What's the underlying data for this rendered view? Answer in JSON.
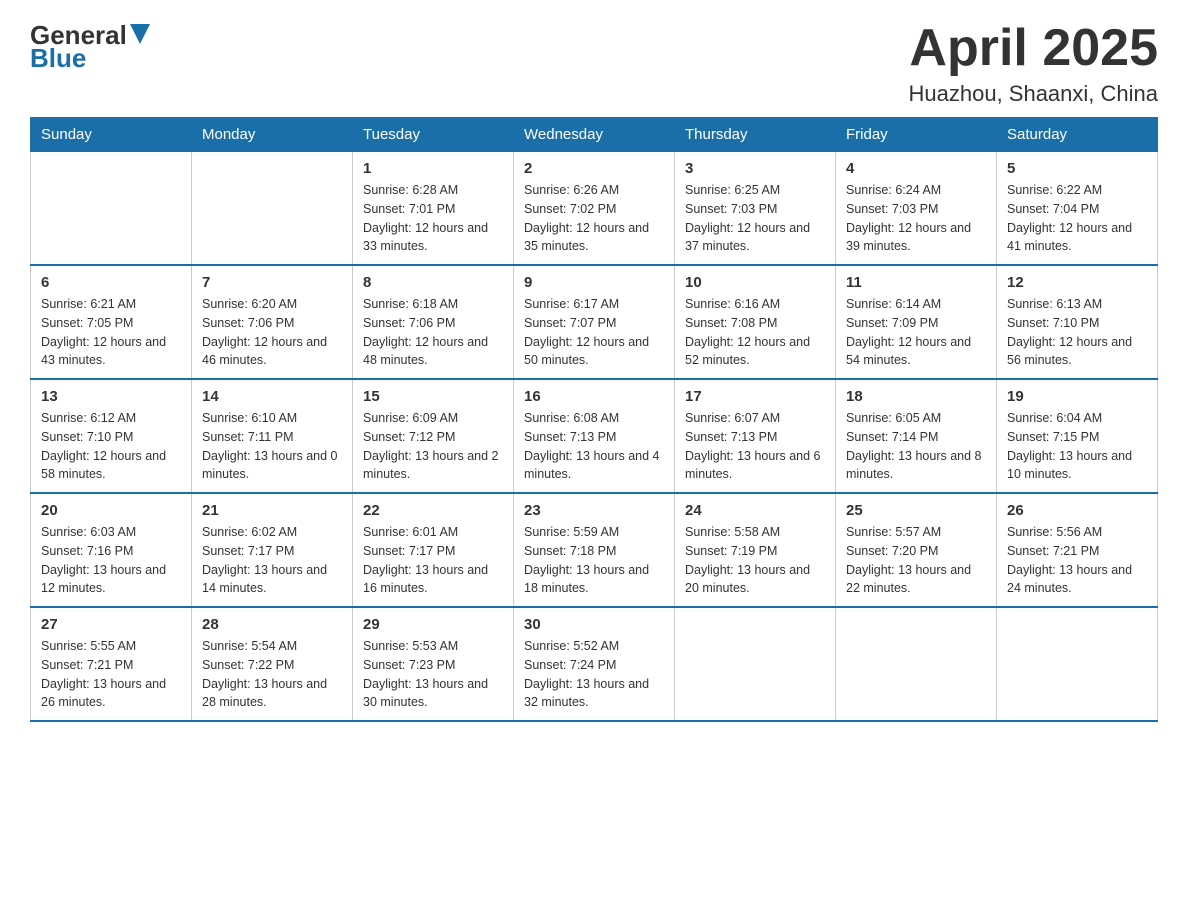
{
  "logo": {
    "general": "General",
    "blue": "Blue"
  },
  "title": "April 2025",
  "subtitle": "Huazhou, Shaanxi, China",
  "days_of_week": [
    "Sunday",
    "Monday",
    "Tuesday",
    "Wednesday",
    "Thursday",
    "Friday",
    "Saturday"
  ],
  "weeks": [
    [
      null,
      null,
      {
        "day": "1",
        "sunrise": "6:28 AM",
        "sunset": "7:01 PM",
        "daylight": "12 hours and 33 minutes."
      },
      {
        "day": "2",
        "sunrise": "6:26 AM",
        "sunset": "7:02 PM",
        "daylight": "12 hours and 35 minutes."
      },
      {
        "day": "3",
        "sunrise": "6:25 AM",
        "sunset": "7:03 PM",
        "daylight": "12 hours and 37 minutes."
      },
      {
        "day": "4",
        "sunrise": "6:24 AM",
        "sunset": "7:03 PM",
        "daylight": "12 hours and 39 minutes."
      },
      {
        "day": "5",
        "sunrise": "6:22 AM",
        "sunset": "7:04 PM",
        "daylight": "12 hours and 41 minutes."
      }
    ],
    [
      {
        "day": "6",
        "sunrise": "6:21 AM",
        "sunset": "7:05 PM",
        "daylight": "12 hours and 43 minutes."
      },
      {
        "day": "7",
        "sunrise": "6:20 AM",
        "sunset": "7:06 PM",
        "daylight": "12 hours and 46 minutes."
      },
      {
        "day": "8",
        "sunrise": "6:18 AM",
        "sunset": "7:06 PM",
        "daylight": "12 hours and 48 minutes."
      },
      {
        "day": "9",
        "sunrise": "6:17 AM",
        "sunset": "7:07 PM",
        "daylight": "12 hours and 50 minutes."
      },
      {
        "day": "10",
        "sunrise": "6:16 AM",
        "sunset": "7:08 PM",
        "daylight": "12 hours and 52 minutes."
      },
      {
        "day": "11",
        "sunrise": "6:14 AM",
        "sunset": "7:09 PM",
        "daylight": "12 hours and 54 minutes."
      },
      {
        "day": "12",
        "sunrise": "6:13 AM",
        "sunset": "7:10 PM",
        "daylight": "12 hours and 56 minutes."
      }
    ],
    [
      {
        "day": "13",
        "sunrise": "6:12 AM",
        "sunset": "7:10 PM",
        "daylight": "12 hours and 58 minutes."
      },
      {
        "day": "14",
        "sunrise": "6:10 AM",
        "sunset": "7:11 PM",
        "daylight": "13 hours and 0 minutes."
      },
      {
        "day": "15",
        "sunrise": "6:09 AM",
        "sunset": "7:12 PM",
        "daylight": "13 hours and 2 minutes."
      },
      {
        "day": "16",
        "sunrise": "6:08 AM",
        "sunset": "7:13 PM",
        "daylight": "13 hours and 4 minutes."
      },
      {
        "day": "17",
        "sunrise": "6:07 AM",
        "sunset": "7:13 PM",
        "daylight": "13 hours and 6 minutes."
      },
      {
        "day": "18",
        "sunrise": "6:05 AM",
        "sunset": "7:14 PM",
        "daylight": "13 hours and 8 minutes."
      },
      {
        "day": "19",
        "sunrise": "6:04 AM",
        "sunset": "7:15 PM",
        "daylight": "13 hours and 10 minutes."
      }
    ],
    [
      {
        "day": "20",
        "sunrise": "6:03 AM",
        "sunset": "7:16 PM",
        "daylight": "13 hours and 12 minutes."
      },
      {
        "day": "21",
        "sunrise": "6:02 AM",
        "sunset": "7:17 PM",
        "daylight": "13 hours and 14 minutes."
      },
      {
        "day": "22",
        "sunrise": "6:01 AM",
        "sunset": "7:17 PM",
        "daylight": "13 hours and 16 minutes."
      },
      {
        "day": "23",
        "sunrise": "5:59 AM",
        "sunset": "7:18 PM",
        "daylight": "13 hours and 18 minutes."
      },
      {
        "day": "24",
        "sunrise": "5:58 AM",
        "sunset": "7:19 PM",
        "daylight": "13 hours and 20 minutes."
      },
      {
        "day": "25",
        "sunrise": "5:57 AM",
        "sunset": "7:20 PM",
        "daylight": "13 hours and 22 minutes."
      },
      {
        "day": "26",
        "sunrise": "5:56 AM",
        "sunset": "7:21 PM",
        "daylight": "13 hours and 24 minutes."
      }
    ],
    [
      {
        "day": "27",
        "sunrise": "5:55 AM",
        "sunset": "7:21 PM",
        "daylight": "13 hours and 26 minutes."
      },
      {
        "day": "28",
        "sunrise": "5:54 AM",
        "sunset": "7:22 PM",
        "daylight": "13 hours and 28 minutes."
      },
      {
        "day": "29",
        "sunrise": "5:53 AM",
        "sunset": "7:23 PM",
        "daylight": "13 hours and 30 minutes."
      },
      {
        "day": "30",
        "sunrise": "5:52 AM",
        "sunset": "7:24 PM",
        "daylight": "13 hours and 32 minutes."
      },
      null,
      null,
      null
    ]
  ],
  "labels": {
    "sunrise": "Sunrise:",
    "sunset": "Sunset:",
    "daylight": "Daylight:"
  }
}
